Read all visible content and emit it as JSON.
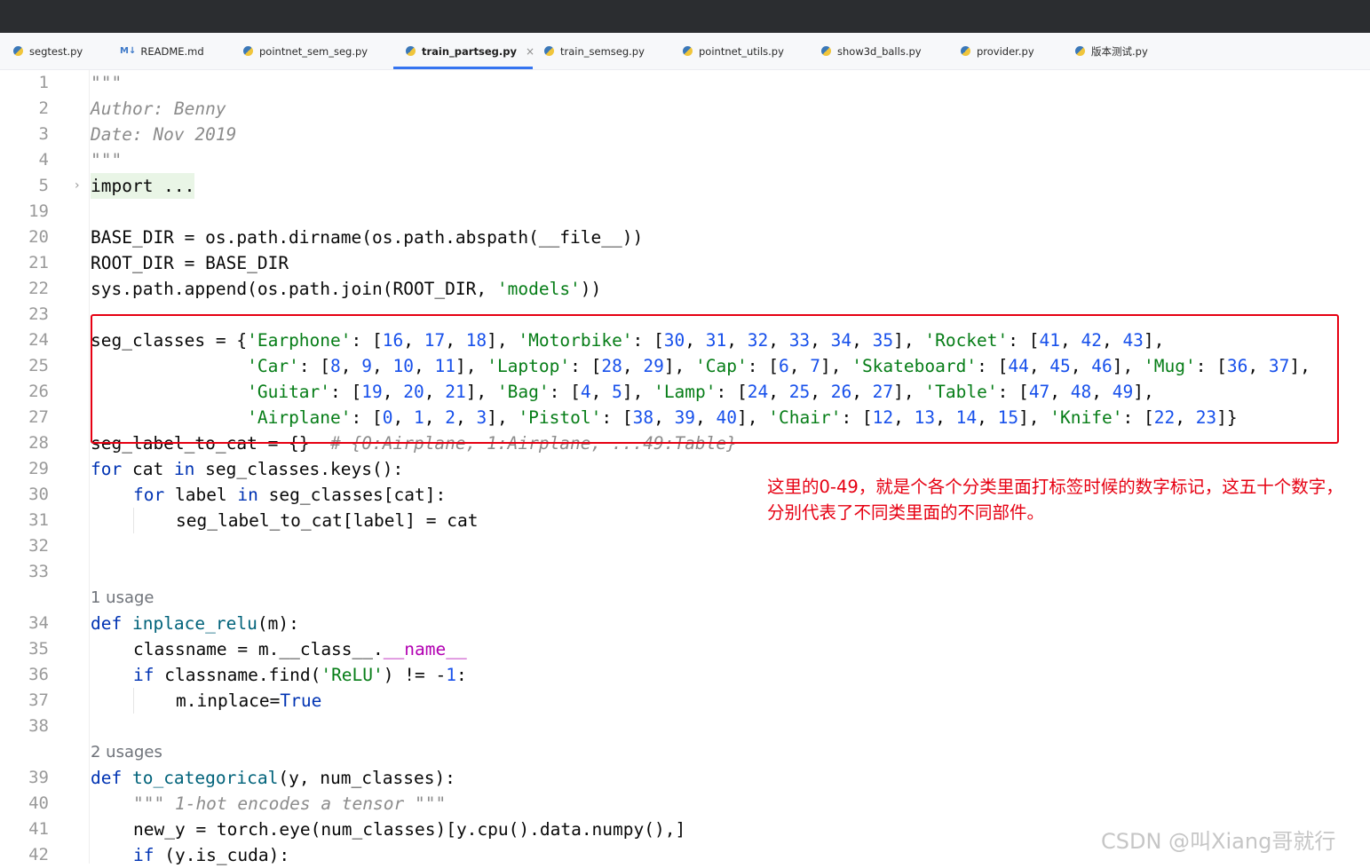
{
  "tabs": [
    {
      "label": "segtest.py",
      "icon": "python-file-icon"
    },
    {
      "label": "README.md",
      "icon": "markdown-file-icon",
      "icon_text": "M↓"
    },
    {
      "label": "pointnet_sem_seg.py",
      "icon": "python-file-icon"
    },
    {
      "label": "train_partseg.py",
      "icon": "python-file-icon",
      "active": true,
      "close": "×"
    },
    {
      "label": "train_semseg.py",
      "icon": "python-file-icon"
    },
    {
      "label": "pointnet_utils.py",
      "icon": "python-file-icon"
    },
    {
      "label": "show3d_balls.py",
      "icon": "python-file-icon"
    },
    {
      "label": "provider.py",
      "icon": "python-file-icon"
    },
    {
      "label": "版本测试.py",
      "icon": "python-file-icon"
    }
  ],
  "editor": {
    "line_numbers": [
      "1",
      "2",
      "3",
      "4",
      "5",
      "19",
      "20",
      "21",
      "22",
      "23",
      "24",
      "25",
      "26",
      "27",
      "28",
      "29",
      "30",
      "31",
      "32",
      "33",
      "34",
      "35",
      "36",
      "37",
      "38",
      "39",
      "40",
      "41",
      "42"
    ],
    "usage_hints": [
      "1 usage",
      "2 usages"
    ],
    "fold_marker": "›",
    "code": {
      "l1": "\"\"\"",
      "l2": "Author: Benny",
      "l3": "Date: Nov 2019",
      "l4": "\"\"\"",
      "l5": "import ...",
      "l20": "BASE_DIR = os.path.dirname(os.path.abspath(__file__))",
      "l21": "ROOT_DIR = BASE_DIR",
      "l22a": "sys.path.append(os.path.join(ROOT_DIR, ",
      "l22s": "'models'",
      "l22b": "))",
      "l24": "seg_classes = {'Earphone': [16, 17, 18], 'Motorbike': [30, 31, 32, 33, 34, 35], 'Rocket': [41, 42, 43],",
      "l25": "               'Car': [8, 9, 10, 11], 'Laptop': [28, 29], 'Cap': [6, 7], 'Skateboard': [44, 45, 46], 'Mug': [36, 37],",
      "l26": "               'Guitar': [19, 20, 21], 'Bag': [4, 5], 'Lamp': [24, 25, 26, 27], 'Table': [47, 48, 49],",
      "l27": "               'Airplane': [0, 1, 2, 3], 'Pistol': [38, 39, 40], 'Chair': [12, 13, 14, 15], 'Knife': [22, 23]}",
      "l28a": "seg_label_to_cat = {}  ",
      "l28c": "# {0:Airplane, 1:Airplane, ...49:Table}",
      "l29kw": "for",
      "l29a": " cat ",
      "l29kw2": "in",
      "l29b": " seg_classes.keys():",
      "l30kw": "for",
      "l30a": " label ",
      "l30kw2": "in",
      "l30b": " seg_classes[cat]:",
      "l31": "seg_label_to_cat[label] = cat",
      "l34kw": "def ",
      "l34fn": "inplace_relu",
      "l34b": "(m):",
      "l35a": "classname = m.__class__.",
      "l35m": "__name__",
      "l36kw": "if",
      "l36a": " classname.find(",
      "l36s": "'ReLU'",
      "l36b": ") != -",
      "l36n": "1",
      "l36c": ":",
      "l37a": "m.inplace=",
      "l37kw": "True",
      "l39kw": "def ",
      "l39fn": "to_categorical",
      "l39b": "(y, num_classes):",
      "l40": "\"\"\" 1-hot encodes a tensor \"\"\"",
      "l41": "new_y = torch.eye(num_classes)[y.cpu().data.numpy(),]",
      "l42kw": "if",
      "l42b": " (y.is_cuda):"
    }
  },
  "annotation": "这里的0-49，就是个各个分类里面打标签时候的数字标记，这五十个数字，分别代表了不同类里面的不同部件。",
  "watermark": "CSDN @叫Xiang哥就行",
  "colors": {
    "annotation": "#e60012",
    "string": "#067d17",
    "number": "#1750eb",
    "keyword": "#0033b3",
    "function": "#00627a",
    "comment": "#8c8c8c"
  }
}
